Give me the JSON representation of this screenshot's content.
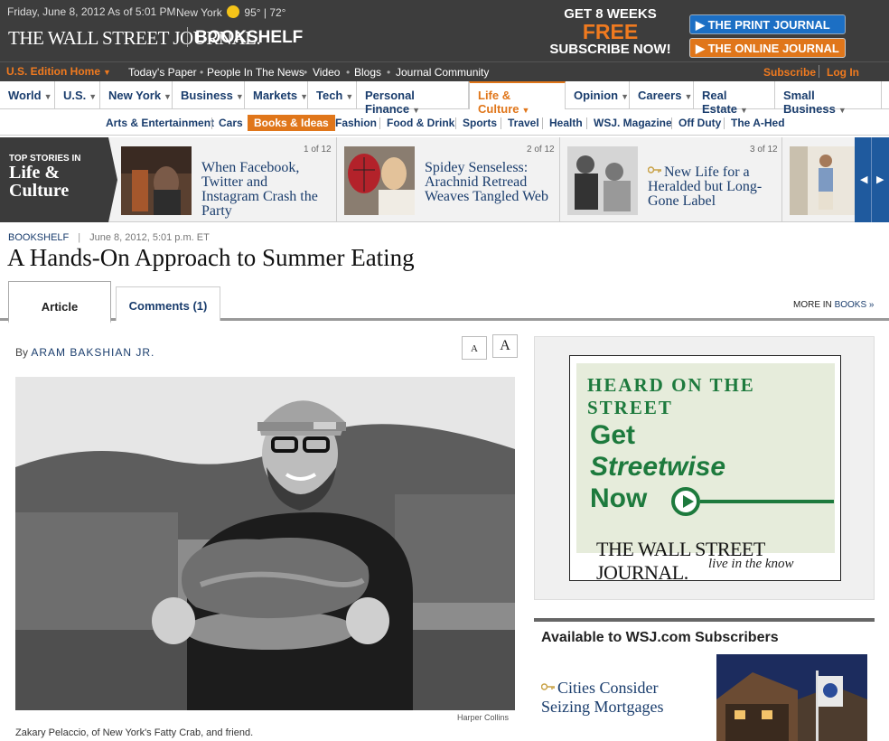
{
  "header": {
    "dateline": "Friday, June 8, 2012 As of 5:01 PM",
    "city": "New York",
    "temps": "95° | 72°",
    "logo": "THE WALL STREET JOURNAL.",
    "section": "BOOKSHELF",
    "promo": {
      "line1": "GET 8 WEEKS",
      "line2": "FREE",
      "line3": "SUBSCRIBE NOW!"
    },
    "print_btn": "THE PRINT JOURNAL",
    "online_btn": "THE ONLINE JOURNAL"
  },
  "edition_bar": {
    "edition": "U.S. Edition Home",
    "links": [
      "Today's Paper",
      "People In The News",
      "Video",
      "Blogs",
      "Journal Community"
    ],
    "subscribe": "Subscribe",
    "login": "Log In"
  },
  "nav": {
    "items": [
      "World",
      "U.S.",
      "New York",
      "Business",
      "Markets",
      "Tech",
      "Personal Finance",
      "Life & Culture",
      "Opinion",
      "Careers",
      "Real Estate",
      "Small Business"
    ]
  },
  "subnav": {
    "items": [
      "Arts & Entertainment",
      "Cars",
      "Books & Ideas",
      "Fashion",
      "Food & Drink",
      "Sports",
      "Travel",
      "Health",
      "WSJ. Magazine",
      "Off Duty",
      "The A-Hed"
    ]
  },
  "top_stories": {
    "label_small": "TOP STORIES IN",
    "label_big": "Life & Culture",
    "stories": [
      {
        "count": "1 of 12",
        "headline": "When Facebook, Twitter and Instagram Crash the Party"
      },
      {
        "count": "2 of 12",
        "headline": "Spidey Senseless: Arachnid Retread Weaves Tangled Web"
      },
      {
        "count": "3 of 12",
        "headline": "New Life for a Heralded but Long-Gone Label"
      }
    ]
  },
  "article": {
    "section": "BOOKSHELF",
    "date": "June 8, 2012, 5:01 p.m. ET",
    "headline": "A Hands-On Approach to Summer Eating",
    "tabs": {
      "article": "Article",
      "comments": "Comments (1)"
    },
    "more_in_prefix": "MORE IN ",
    "more_in_link": "BOOKS »",
    "byline_prefix": "By ",
    "author": "ARAM BAKSHIAN JR.",
    "font_small": "A",
    "font_large": "A",
    "photo_credit": "Harper Collins",
    "caption": "Zakary Pelaccio, of New York's Fatty Crab, and friend."
  },
  "ad": {
    "heading": "HEARD ON THE STREET",
    "get": "Get",
    "streetwise": "Streetwise",
    "now": "Now",
    "logo": "THE WALL STREET JOURNAL.",
    "tagline": "live in the know"
  },
  "subscribers": {
    "heading": "Available to WSJ.com Subscribers",
    "story": "Cities Consider Seizing Mortgages"
  },
  "colors": {
    "accent": "#e0761a",
    "link": "#1a3d6d",
    "header_bg": "#3d3d3d",
    "ad_green": "#1d7a3d"
  }
}
